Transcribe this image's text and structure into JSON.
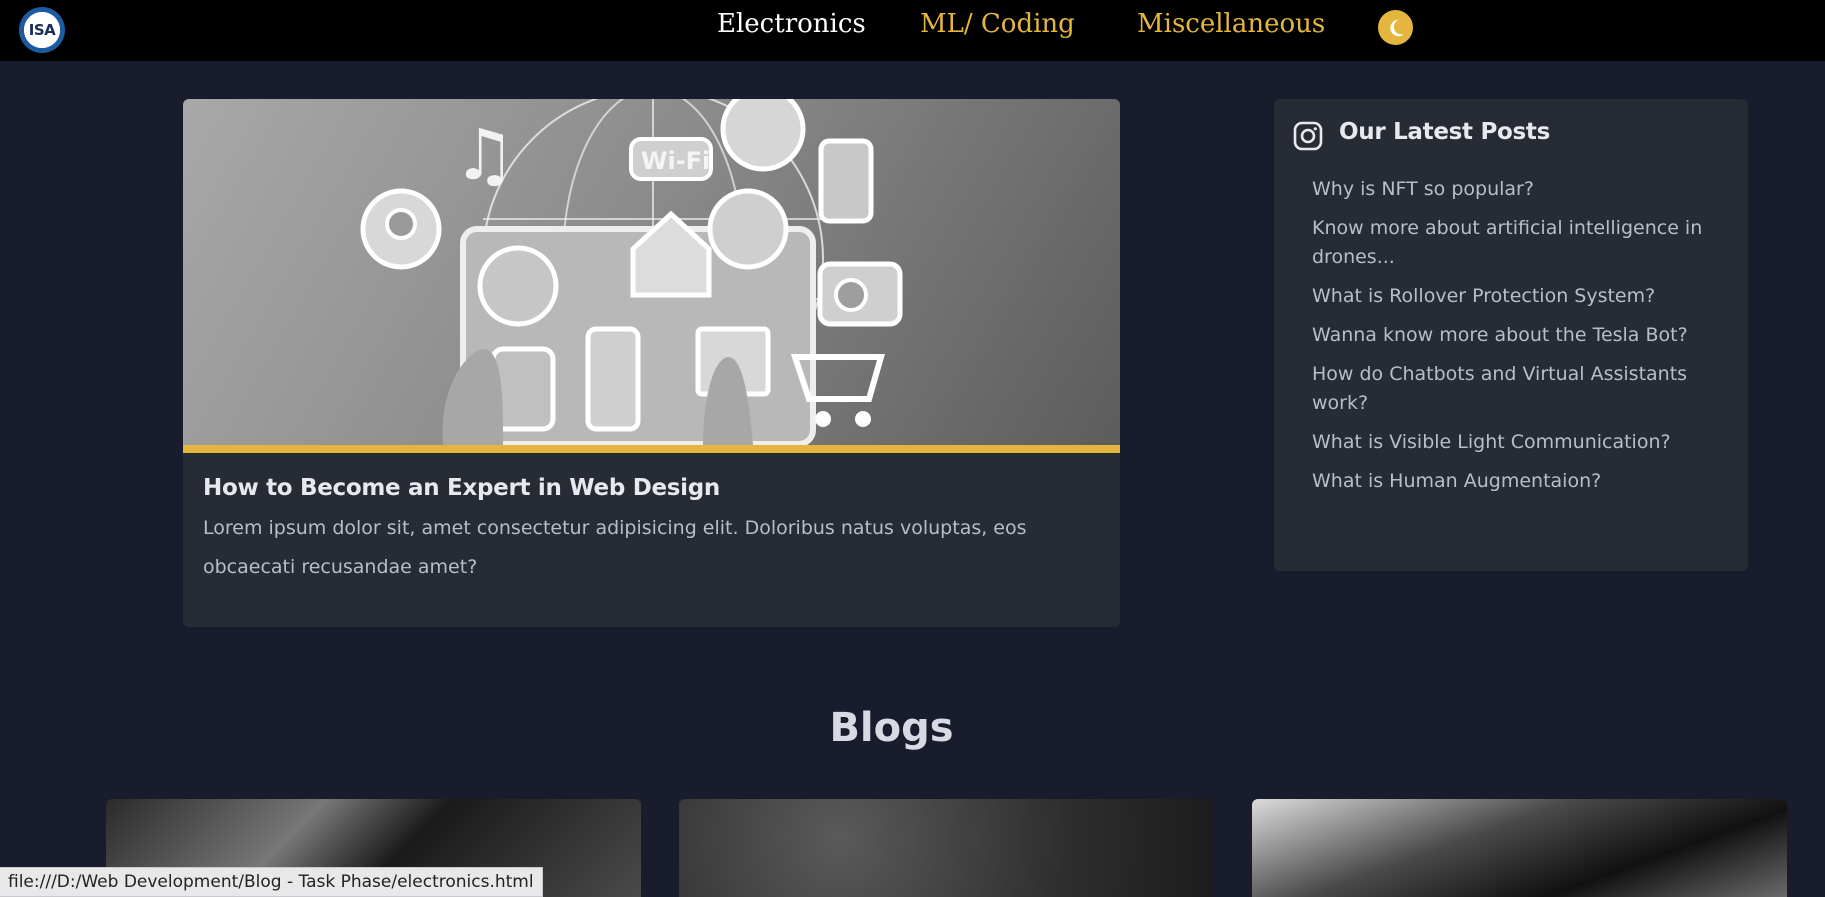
{
  "navbar": {
    "logo_text": "ISA",
    "links": [
      {
        "label": "Electronics",
        "active": true
      },
      {
        "label": "ML/ Coding",
        "active": false
      },
      {
        "label": "Miscellaneous",
        "active": false
      }
    ],
    "theme_toggle_icon": "moon-icon",
    "accent_color": "#e4b63e"
  },
  "featured": {
    "title": "How to Become an Expert in Web Design",
    "excerpt": "Lorem ipsum dolor sit, amet consectetur adipisicing elit. Doloribus natus voluptas, eos obcaecati recusandae amet?"
  },
  "latest_posts": {
    "heading": "Our Latest Posts",
    "icon": "instagram-icon",
    "items": [
      "Why is NFT so popular?",
      "Know more about artificial intelligence in drones...",
      "What is Rollover Protection System?",
      "Wanna know more about the Tesla Bot?",
      "How do Chatbots and Virtual Assistants work?",
      "What is Visible Light Communication?",
      "What is Human Augmentaion?"
    ]
  },
  "blogs": {
    "heading": "Blogs"
  },
  "status_bar": {
    "url": "file:///D:/Web Development/Blog - Task Phase/electronics.html"
  }
}
